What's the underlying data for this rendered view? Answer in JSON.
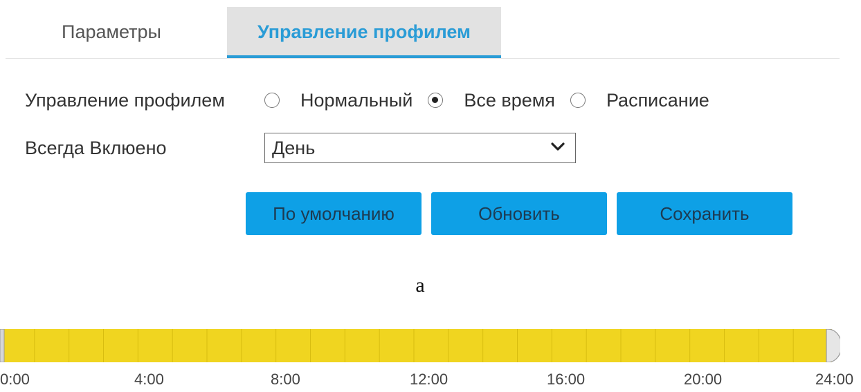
{
  "tabs": [
    {
      "label": "Параметры",
      "active": false
    },
    {
      "label": "Управление профилем",
      "active": true
    }
  ],
  "profile_mode": {
    "label": "Управление профилем",
    "options": [
      {
        "label": "Нормальный",
        "checked": false
      },
      {
        "label": "Все время",
        "checked": true
      },
      {
        "label": "Расписание",
        "checked": false
      }
    ]
  },
  "always_on": {
    "label": "Всегда Вклюено",
    "selected": "День"
  },
  "buttons": {
    "default_label": "По умолчанию",
    "update_label": "Обновить",
    "save_label": "Сохранить"
  },
  "caption": "a",
  "timeline": {
    "ticks": [
      "0:00",
      "4:00",
      "8:00",
      "12:00",
      "16:00",
      "20:00",
      "24:00"
    ],
    "range_start": 0,
    "range_end": 24,
    "bar_color": "#f0d520"
  },
  "colors": {
    "accent": "#2a9cd6",
    "button": "#0ea0e6"
  }
}
